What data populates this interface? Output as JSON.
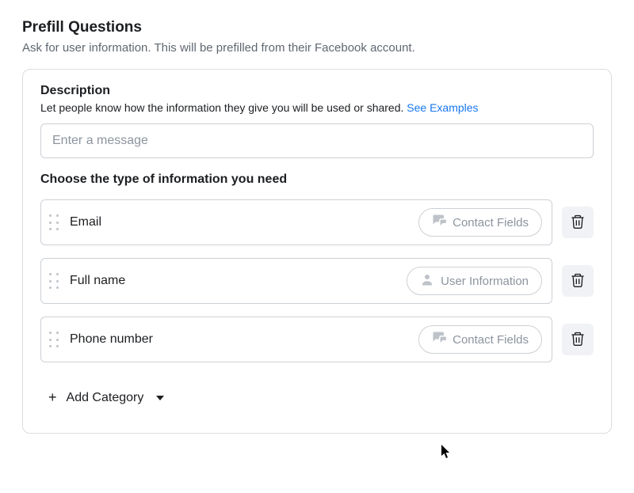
{
  "header": {
    "title": "Prefill Questions",
    "subtitle": "Ask for user information. This will be prefilled from their Facebook account."
  },
  "description_section": {
    "title": "Description",
    "help_text": "Let people know how the information they give you will be used or shared. ",
    "link_text": "See Examples",
    "input_placeholder": "Enter a message",
    "input_value": ""
  },
  "fields_section": {
    "title": "Choose the type of information you need",
    "items": [
      {
        "label": "Email",
        "category": "Contact Fields",
        "icon": "chat"
      },
      {
        "label": "Full name",
        "category": "User Information",
        "icon": "user"
      },
      {
        "label": "Phone number",
        "category": "Contact Fields",
        "icon": "chat"
      }
    ]
  },
  "add_category": {
    "label": "Add Category"
  }
}
